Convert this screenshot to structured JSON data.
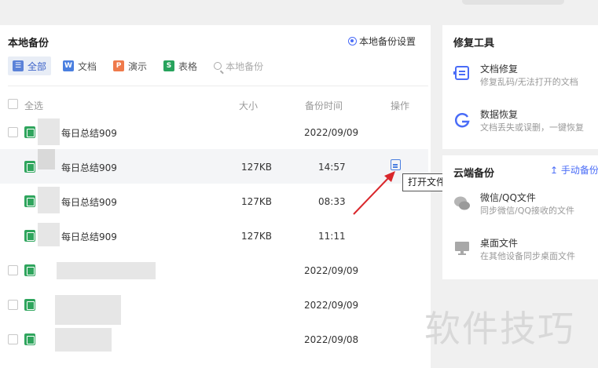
{
  "local_backup": {
    "title": "本地备份",
    "settings_label": "本地备份设置",
    "filters": [
      {
        "label": "全部",
        "icon": "list-icon",
        "active": true
      },
      {
        "label": "文档",
        "icon": "W"
      },
      {
        "label": "演示",
        "icon": "P"
      },
      {
        "label": "表格",
        "icon": "S"
      }
    ],
    "search_placeholder": "本地备份",
    "columns": {
      "select_all": "全选",
      "size": "大小",
      "time": "备份时间",
      "action": "操作"
    },
    "rows": [
      {
        "name": "每日总结909",
        "size": "",
        "time": "2022/09/09"
      },
      {
        "name": "每日总结909",
        "size": "127KB",
        "time": "14:57"
      },
      {
        "name": "每日总结909",
        "size": "127KB",
        "time": "08:33"
      },
      {
        "name": "每日总结909",
        "size": "127KB",
        "time": "11:11"
      },
      {
        "name": "",
        "size": "",
        "time": "2022/09/09"
      },
      {
        "name": "",
        "size": "",
        "time": "2022/09/09"
      },
      {
        "name": "",
        "size": "",
        "time": "2022/09/08"
      }
    ],
    "tooltip": "打开文件"
  },
  "repair_tools": {
    "title": "修复工具",
    "items": [
      {
        "title": "文档修复",
        "subtitle": "修复乱码/无法打开的文档"
      },
      {
        "title": "数据恢复",
        "subtitle": "文档丢失或误删，一键恢复"
      }
    ]
  },
  "cloud_backup": {
    "title": "云端备份",
    "manual_label": "手动备份",
    "items": [
      {
        "title": "微信/QQ文件",
        "subtitle": "同步微信/QQ接收的文件"
      },
      {
        "title": "桌面文件",
        "subtitle": "在其他设备同步桌面文件"
      }
    ]
  },
  "watermark": "软件技巧",
  "colors": {
    "accent": "#4a6cf7",
    "sheet_green": "#2fa55d",
    "arrow_red": "#d9262b"
  }
}
